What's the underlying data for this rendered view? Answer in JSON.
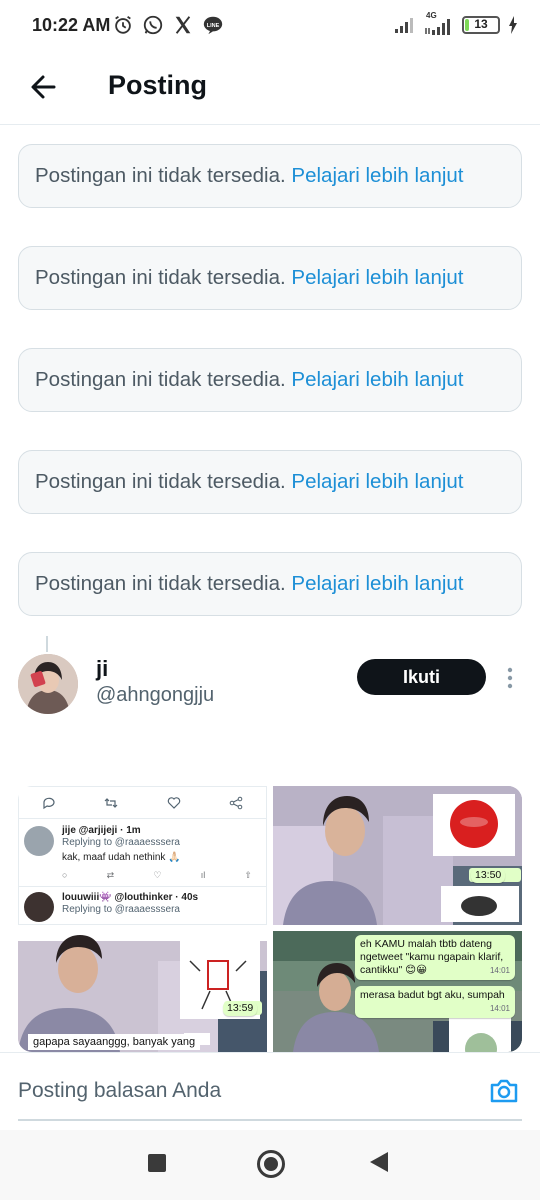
{
  "status_bar": {
    "time": "10:22 AM",
    "network": "4G",
    "battery_level": "13",
    "battery_fraction": 0.13,
    "icons_left": [
      "alarm-icon",
      "whatsapp-icon",
      "x-icon",
      "line-icon"
    ],
    "icons_right": [
      "signal-icon",
      "signal-4g-icon",
      "battery-icon",
      "charging-icon"
    ]
  },
  "header": {
    "back_icon": "back-arrow-icon",
    "title": "Posting"
  },
  "notices": [
    {
      "text": "Postingan ini tidak tersedia.",
      "link": "Pelajari lebih lanjut"
    },
    {
      "text": "Postingan ini tidak tersedia.",
      "link": "Pelajari lebih lanjut"
    },
    {
      "text": "Postingan ini tidak tersedia.",
      "link": "Pelajari lebih lanjut"
    },
    {
      "text": "Postingan ini tidak tersedia.",
      "link": "Pelajari lebih lanjut"
    },
    {
      "text": "Postingan ini tidak tersedia.",
      "link": "Pelajari lebih lanjut"
    }
  ],
  "post": {
    "author_name": "ji",
    "author_handle": "@ahngongjju",
    "follow_label": "Ikuti",
    "more_icon": "more-vertical-icon"
  },
  "media": {
    "tile_a": {
      "reply1_name": "jije @arjijeji · 1m",
      "reply1_to": "Replying to @raaaesssera",
      "reply1_text": "kak, maaf udah nethink 🙏🏻",
      "reply2_name": "louuwiii👾 @louthinker · 40s",
      "reply2_to": "Replying to @raaaesssera"
    },
    "tile_b": {
      "time": "13:50"
    },
    "tile_c": {
      "time": "13:59",
      "caption": "gapapa sayaanggg, banyak yang"
    },
    "tile_d": {
      "bubble1": "eh KAMU malah tbtb dateng ngetweet \"kamu ngapain klarif, cantikku\" 😊😀",
      "bubble1_time": "14:01",
      "bubble2": "merasa badut bgt aku, sumpah",
      "bubble2_time": "14:01"
    }
  },
  "reply_bar": {
    "placeholder": "Posting balasan Anda",
    "camera_icon": "camera-icon"
  },
  "nav_bar": {
    "icons": [
      "recent-apps-icon",
      "home-icon",
      "back-icon"
    ]
  },
  "colors": {
    "link": "#1d8fd6",
    "notice_bg": "#f6f8f9",
    "follow_bg": "#0f1419",
    "chat_bubble": "#e1ffc7"
  }
}
